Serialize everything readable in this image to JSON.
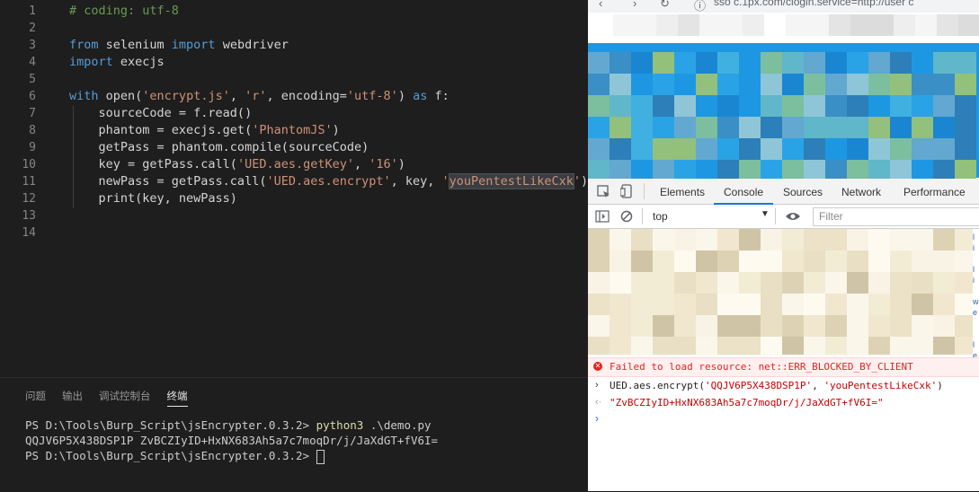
{
  "editor": {
    "line_numbers": [
      "1",
      "2",
      "3",
      "4",
      "5",
      "6",
      "7",
      "8",
      "9",
      "10",
      "11",
      "12",
      "13",
      "14"
    ],
    "lines": [
      [
        {
          "t": "# coding: utf-8",
          "c": "cm"
        }
      ],
      [],
      [
        {
          "t": "from",
          "c": "kw"
        },
        {
          "t": " selenium "
        },
        {
          "t": "import",
          "c": "kw"
        },
        {
          "t": " webdriver"
        }
      ],
      [
        {
          "t": "import",
          "c": "kw"
        },
        {
          "t": " execjs"
        }
      ],
      [],
      [
        {
          "t": "with",
          "c": "kw"
        },
        {
          "t": " open("
        },
        {
          "t": "'encrypt.js'",
          "c": "st"
        },
        {
          "t": ", "
        },
        {
          "t": "'r'",
          "c": "st"
        },
        {
          "t": ", encoding="
        },
        {
          "t": "'utf-8'",
          "c": "st"
        },
        {
          "t": ") "
        },
        {
          "t": "as",
          "c": "kw"
        },
        {
          "t": " f:"
        }
      ],
      [
        {
          "t": "    sourceCode = f.read()"
        }
      ],
      [
        {
          "t": "    phantom = execjs.get("
        },
        {
          "t": "'PhantomJS'",
          "c": "st"
        },
        {
          "t": ")"
        }
      ],
      [
        {
          "t": "    getPass = phantom.compile(sourceCode)"
        }
      ],
      [
        {
          "t": "    key = getPass.call("
        },
        {
          "t": "'UED.aes.getKey'",
          "c": "st"
        },
        {
          "t": ", "
        },
        {
          "t": "'16'",
          "c": "st"
        },
        {
          "t": ")"
        }
      ],
      [
        {
          "t": "    newPass = getPass.call("
        },
        {
          "t": "'UED.aes.encrypt'",
          "c": "st"
        },
        {
          "t": ", key, "
        },
        {
          "t": "'",
          "c": "st"
        },
        {
          "t": "youPentestLikeCxk",
          "c": "st hl"
        },
        {
          "t": "'",
          "c": "st"
        },
        {
          "t": ")"
        }
      ],
      [
        {
          "t": "    print(key, newPass)"
        }
      ],
      [],
      []
    ]
  },
  "panel": {
    "tabs": [
      "问题",
      "输出",
      "调试控制台",
      "终端"
    ],
    "active_tab": "终端",
    "terminal": {
      "line1_prompt": "PS D:\\Tools\\Burp_Script\\jsEncrypter.0.3.2> ",
      "line1_cmd": "python3",
      "line1_arg": " .\\demo.py",
      "line2": "QQJV6P5X438DSP1P ZvBCZIyID+HxNX683Ah5a7c7moqDr/j/JaXdGT+fV6I=",
      "line3_prompt": "PS D:\\Tools\\Burp_Script\\jsEncrypter.0.3.2> "
    }
  },
  "browser": {
    "url_text": "sso  c.1px.com/clogin.service=http://user  c",
    "devtools": {
      "tabs": [
        "Elements",
        "Console",
        "Sources",
        "Network",
        "Performance"
      ],
      "active_tab": "Console",
      "context": "top",
      "filter_placeholder": "Filter",
      "error_message": "Failed to load resource: net::ERR_BLOCKED_BY_CLIENT",
      "input_prefix": "UED.aes.encrypt(",
      "input_arg1": "'QQJV6P5X438DSP1P'",
      "input_sep": ", ",
      "input_arg2": "'youPentestLikeCxk'",
      "input_suffix": ")",
      "output": "\"ZvBCZIyID+HxNX683Ah5a7c7moqDr/j/JaXdGT+fV6I=\""
    }
  },
  "colors": {
    "editor_bg": "#1e1e1e",
    "keyword": "#569cd6",
    "string": "#ce9178",
    "comment": "#6a9955",
    "error": "#e52222",
    "devtools_accent": "#1a73e8"
  }
}
